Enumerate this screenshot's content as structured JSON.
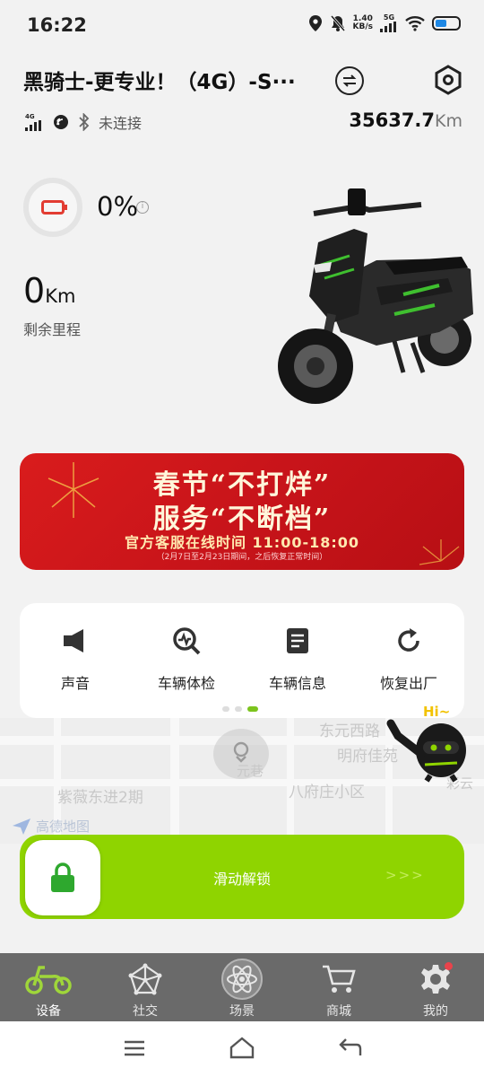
{
  "status_bar": {
    "time": "16:22",
    "net_speed_value": "1.40",
    "net_speed_unit": "KB/s",
    "network": "5G"
  },
  "header": {
    "device_title": "黑骑士-更专业！（4G）-S···",
    "connection_status": "未连接",
    "network_badge": "4G",
    "odometer_value": "35637.7",
    "odometer_unit": "Km"
  },
  "vehicle": {
    "battery_percent": "0%",
    "range_value": "0",
    "range_unit": "Km",
    "range_label": "剩余里程"
  },
  "banner": {
    "line1": "春节“不打烊”",
    "line2": "服务“不断档”",
    "line3": "官方客服在线时间 11:00-18:00",
    "line4": "（2月7日至2月23日期间，之后恢复正常时间）"
  },
  "quick_actions": [
    {
      "label": "声音",
      "icon": "speaker-icon"
    },
    {
      "label": "车辆体检",
      "icon": "checkup-icon"
    },
    {
      "label": "车辆信息",
      "icon": "document-icon"
    },
    {
      "label": "恢复出厂",
      "icon": "restore-icon"
    }
  ],
  "pager": {
    "count": 3,
    "active_index": 2
  },
  "map": {
    "labels": [
      "紫薇东进2期",
      "八府庄小区",
      "明府佳苑",
      "东元西路",
      "元巷",
      "彩云",
      "高德地图"
    ],
    "mascot_greeting": "Hi~"
  },
  "unlock_slider": {
    "label": "滑动解锁",
    "arrows": ">>>"
  },
  "bottom_nav": [
    {
      "label": "设备",
      "icon": "scooter-icon",
      "active": true
    },
    {
      "label": "社交",
      "icon": "network-icon",
      "active": false
    },
    {
      "label": "场景",
      "icon": "atom-icon",
      "active": false
    },
    {
      "label": "商城",
      "icon": "cart-icon",
      "active": false
    },
    {
      "label": "我的",
      "icon": "gear-icon",
      "active": false,
      "badge": true
    }
  ],
  "colors": {
    "accent_green": "#8fd400",
    "banner_red": "#d91c1c",
    "battery_red": "#e23c32",
    "nav_bg": "#6a6a6a"
  }
}
